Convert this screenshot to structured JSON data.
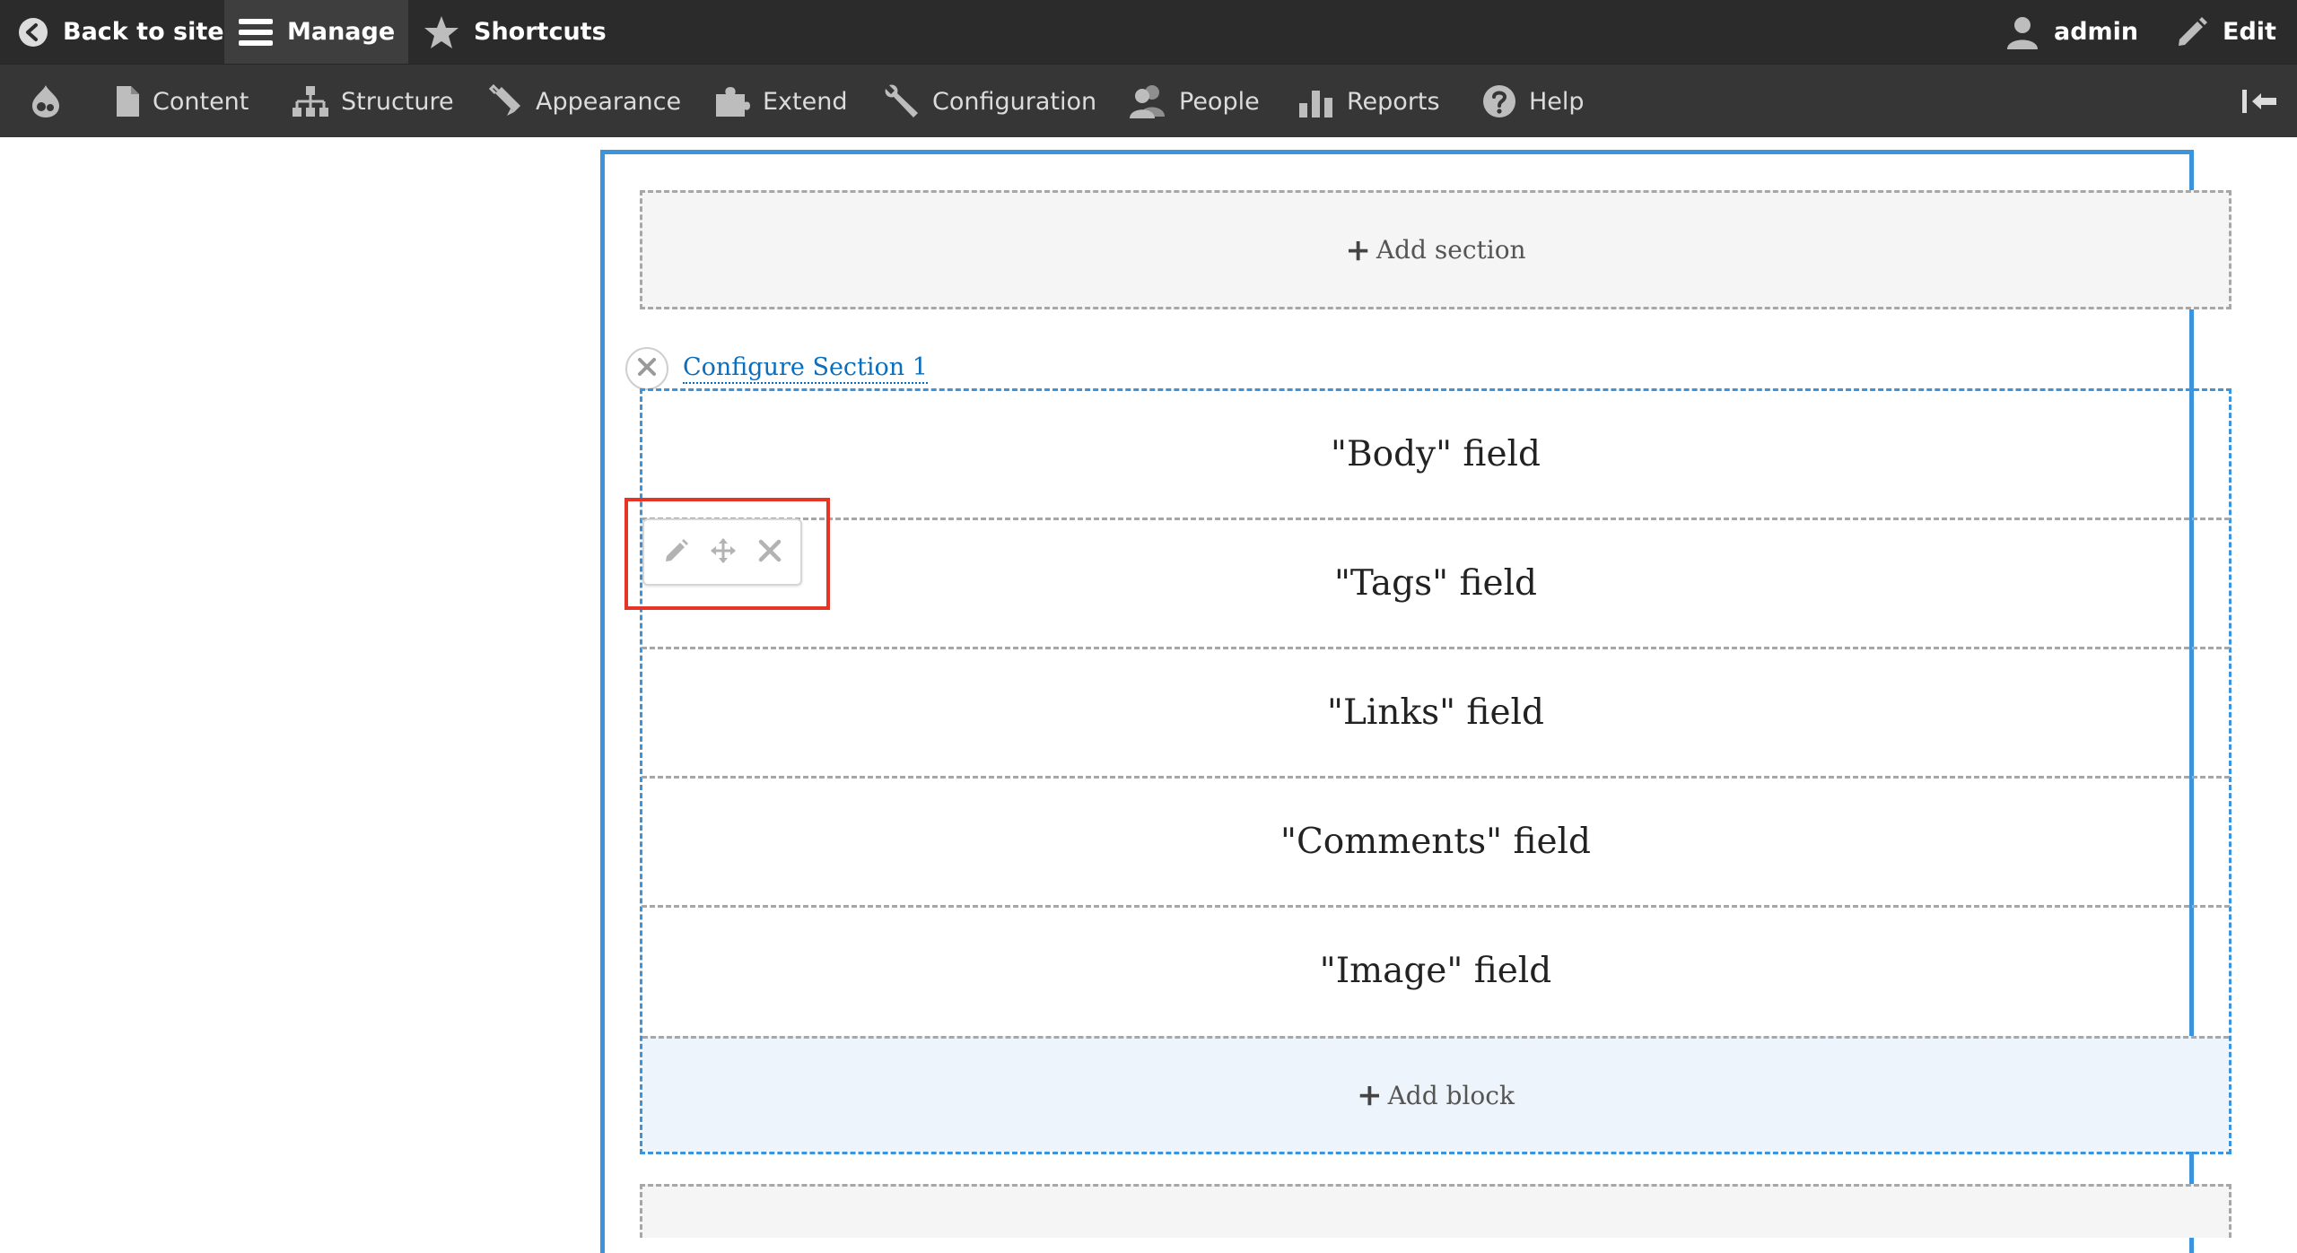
{
  "toolbar": {
    "back_to_site": "Back to site",
    "manage": "Manage",
    "shortcuts": "Shortcuts",
    "user": "admin",
    "edit": "Edit"
  },
  "tray": {
    "items": [
      {
        "label": "Content",
        "icon": "file-icon"
      },
      {
        "label": "Structure",
        "icon": "sitemap-icon"
      },
      {
        "label": "Appearance",
        "icon": "paintbrush-icon"
      },
      {
        "label": "Extend",
        "icon": "puzzle-icon"
      },
      {
        "label": "Configuration",
        "icon": "wrench-icon"
      },
      {
        "label": "People",
        "icon": "people-icon"
      },
      {
        "label": "Reports",
        "icon": "bar-chart-icon"
      },
      {
        "label": "Help",
        "icon": "help-icon"
      }
    ]
  },
  "builder": {
    "add_section": "Add section",
    "configure_section": "Configure Section 1",
    "add_block": "Add block",
    "blocks": [
      {
        "label": "\"Body\" field"
      },
      {
        "label": "\"Tags\" field"
      },
      {
        "label": "\"Links\" field"
      },
      {
        "label": "\"Comments\" field"
      },
      {
        "label": "\"Image\" field"
      }
    ]
  },
  "colors": {
    "toolbar_bg": "#2b2b2b",
    "tray_bg": "#363636",
    "accent_blue": "#3c94dd",
    "highlight_red": "#e53527",
    "link_blue": "#0a6ebd"
  }
}
